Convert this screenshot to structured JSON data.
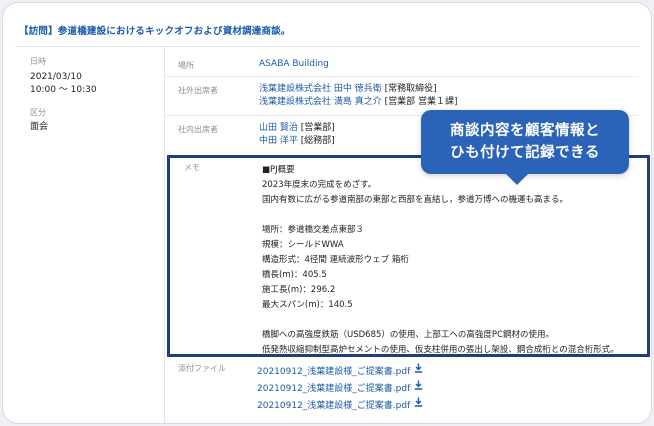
{
  "title": "【訪問】参道橋建設におけるキックオフおよび資材調達商談。",
  "left": {
    "date_label": "日時",
    "date": "2021/03/10",
    "time": "10:00 〜 10:30",
    "type_label": "区分",
    "type": "面会"
  },
  "place": {
    "label": "場所",
    "value": "ASABA Building"
  },
  "external": {
    "label": "社外出席者",
    "people": [
      {
        "company": "浅葉建設株式会社",
        "name": "田中 徳兵衛",
        "role": "[常務取締役]"
      },
      {
        "company": "浅葉建設株式会社",
        "name": "満島 真之介",
        "role": "[営業部 営業１課]"
      }
    ]
  },
  "internal": {
    "label": "社内出席者",
    "people": [
      {
        "name": "山田 賢治",
        "role": "[営業部]"
      },
      {
        "name": "中田 洋平",
        "role": "[総務部]"
      }
    ]
  },
  "memo": {
    "label": "メモ",
    "lines": [
      "■PJ概要",
      "2023年度末の完成をめざす。",
      "国内有数に広がる参道南部の東部と西部を直結し，参道万博への機運も高まる。",
      "",
      "場所：参道橋交差点東部３",
      "規模：シールドWWA",
      "構造形式：4径間 連続波形ウェブ 箱桁",
      "橋長(m)：405.5",
      "施工長(m)：296.2",
      "最大スパン(m)：140.5",
      "",
      "橋脚への高強度鉄筋（USD685）の使用、上部工への高強度PC鋼材の使用。",
      "低発熱収縮抑制型高炉セメントの使用、仮支柱併用の張出し架設、鋼合成桁との混合桁形式。"
    ]
  },
  "callout": {
    "line1": "商談内容を顧客情報と",
    "line2": "ひも付けて記録できる"
  },
  "attachments": {
    "label": "添付ファイル",
    "files": [
      "20210912_浅葉建設様_ご提案書.pdf",
      "20210912_浅葉建設様_ご提案書.pdf",
      "20210912_浅葉建設様_ご提案書.pdf"
    ],
    "download_icon": "download-icon"
  },
  "colors": {
    "accent": "#1a5aa8",
    "callout": "#2b63b8",
    "highlight_border": "#1e3f7a"
  }
}
